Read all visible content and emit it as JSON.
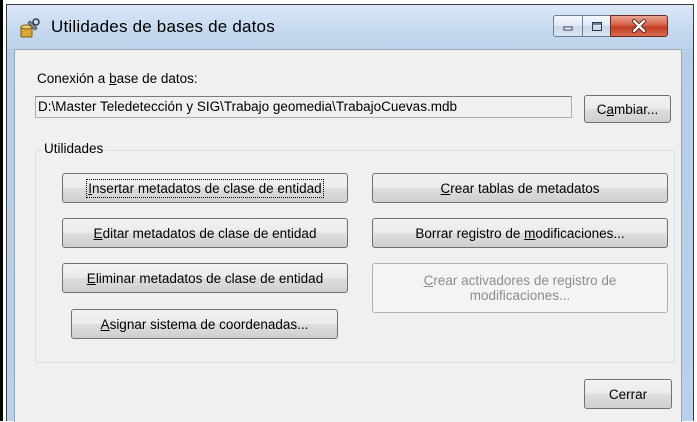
{
  "window": {
    "title": "Utilidades de bases de datos",
    "icon": "database-utilities-icon",
    "controls": [
      "minimize-icon",
      "maximize-icon",
      "close-icon"
    ],
    "colors": {
      "close_button": "#c43c22",
      "frame": "#b9d1ea",
      "client": "#f0f0f0"
    }
  },
  "connection": {
    "label_pre": "Conexión a ",
    "label_key": "b",
    "label_post": "ase de datos:",
    "path": "D:\\Master Teledetección y SIG\\Trabajo geomedia\\TrabajoCuevas.mdb",
    "change_pre": "C",
    "change_key": "a",
    "change_post": "mbiar..."
  },
  "utilities": {
    "legend": "Utilidades",
    "insert": {
      "pre": "",
      "key": "I",
      "post": "nsertar metadatos de clase de entidad"
    },
    "edit": {
      "pre": "",
      "key": "E",
      "post": "ditar metadatos de clase de entidad"
    },
    "delete": {
      "pre": "",
      "key": "E",
      "post": "liminar metadatos de clase de entidad"
    },
    "assign": {
      "pre": "",
      "key": "A",
      "post": "signar sistema de coordenadas..."
    },
    "create_tables": {
      "pre": "",
      "key": "C",
      "post": "rear tablas de metadatos"
    },
    "clear_log": {
      "pre": "Borrar registro de ",
      "key": "m",
      "post": "odificaciones..."
    },
    "create_triggers": {
      "pre": "",
      "key": "C",
      "post": "rear activadores de registro de modificaciones..."
    }
  },
  "footer": {
    "close_label": "Cerrar"
  }
}
